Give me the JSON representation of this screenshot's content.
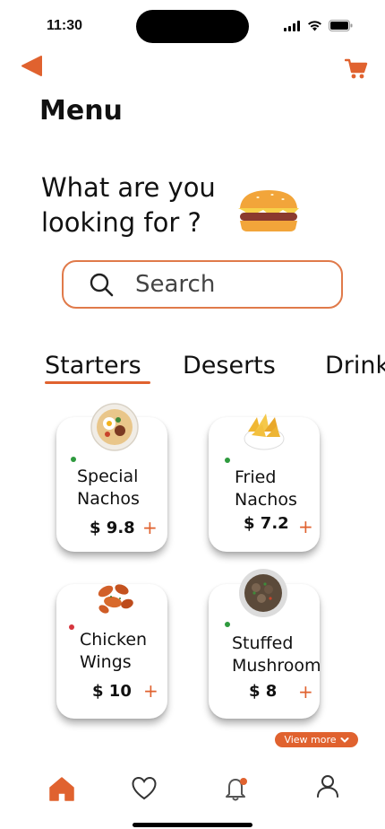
{
  "status_bar": {
    "time": "11:30"
  },
  "header": {
    "title": "Menu"
  },
  "headline": {
    "line1": "What are you",
    "line2": "looking for ?"
  },
  "search": {
    "placeholder": "Search"
  },
  "tabs": [
    {
      "label": "Starters",
      "active": true
    },
    {
      "label": "Deserts",
      "active": false
    },
    {
      "label": "Drinks",
      "active": false
    }
  ],
  "items": [
    {
      "name_line1": "Special",
      "name_line2": "Nachos",
      "price": "$ 9.8",
      "add": "+",
      "indicator": "green"
    },
    {
      "name_line1": "Fried",
      "name_line2": "Nachos",
      "price": "$ 7.2",
      "add": "+",
      "indicator": "green"
    },
    {
      "name_line1": "Chicken",
      "name_line2": "Wings",
      "price": "$ 10",
      "add": "+",
      "indicator": "red"
    },
    {
      "name_line1": "Stuffed",
      "name_line2": "Mushroom",
      "price": "$ 8",
      "add": "+",
      "indicator": "green"
    }
  ],
  "view_more": {
    "label": "View more"
  },
  "bottom_nav": [
    {
      "icon": "home-icon",
      "active": true
    },
    {
      "icon": "heart-icon",
      "active": false
    },
    {
      "icon": "bell-icon",
      "active": false,
      "has_badge": true
    },
    {
      "icon": "user-icon",
      "active": false
    }
  ],
  "colors": {
    "accent": "#e0622f",
    "veg": "#2e9a3e",
    "nonveg": "#d6363e"
  }
}
